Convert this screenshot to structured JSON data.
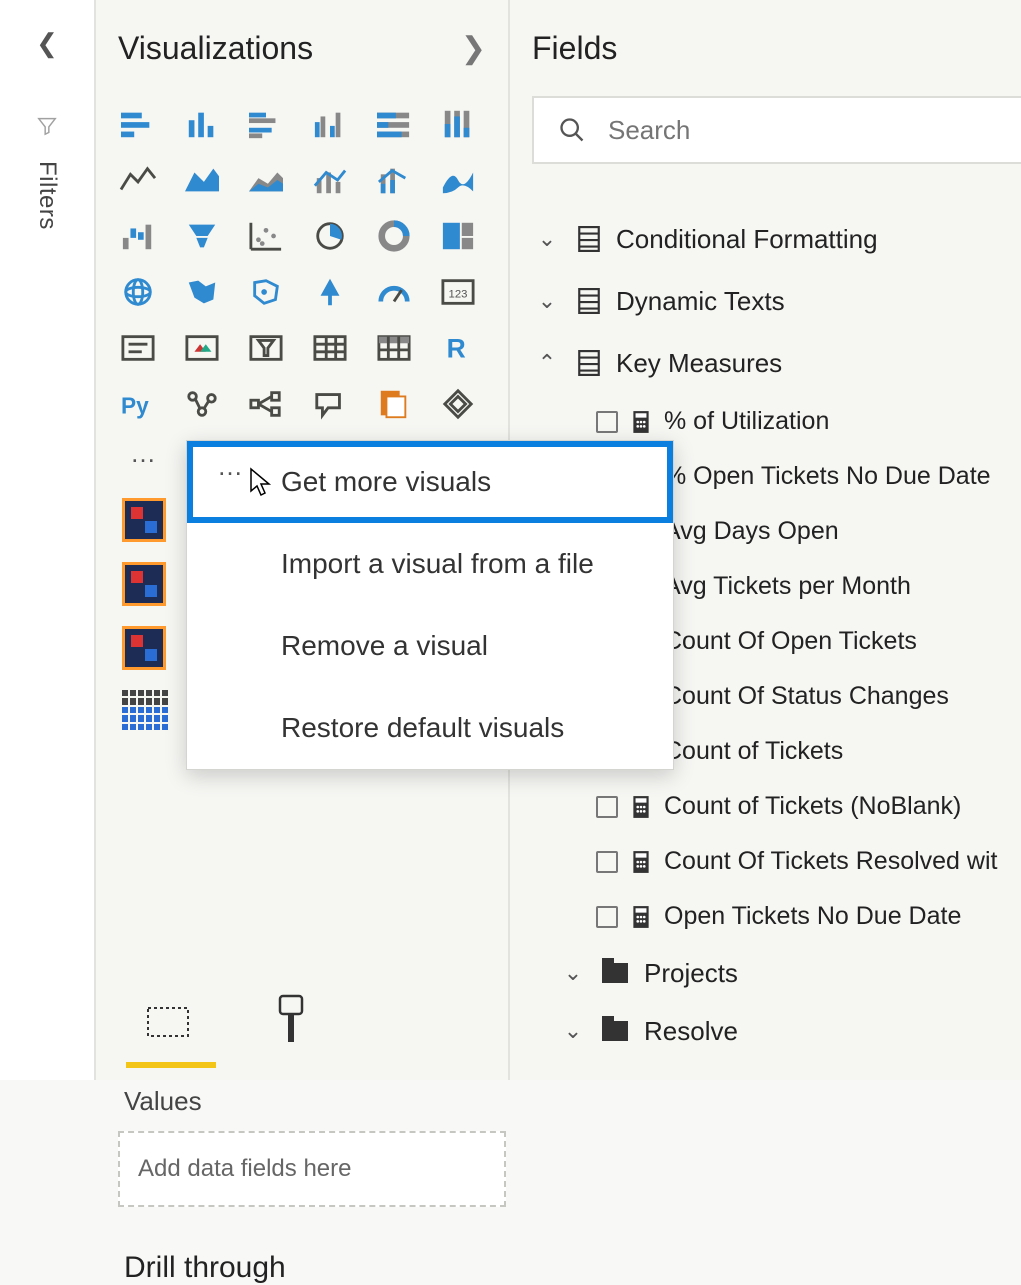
{
  "filters_rail": {
    "label": "Filters"
  },
  "viz": {
    "title": "Visualizations",
    "values_label": "Values",
    "drop_hint": "Add data fields here",
    "drill_label": "Drill through",
    "icons": [
      {
        "name": "stacked-bar-h"
      },
      {
        "name": "stacked-column"
      },
      {
        "name": "clustered-bar-h"
      },
      {
        "name": "clustered-column"
      },
      {
        "name": "hundred-bar-h"
      },
      {
        "name": "hundred-column"
      },
      {
        "name": "line-chart"
      },
      {
        "name": "area-chart"
      },
      {
        "name": "stacked-area"
      },
      {
        "name": "line-clustered"
      },
      {
        "name": "line-stacked"
      },
      {
        "name": "ribbon-chart"
      },
      {
        "name": "waterfall"
      },
      {
        "name": "funnel"
      },
      {
        "name": "scatter"
      },
      {
        "name": "pie"
      },
      {
        "name": "donut"
      },
      {
        "name": "treemap"
      },
      {
        "name": "map-globe"
      },
      {
        "name": "filled-map"
      },
      {
        "name": "shape-map"
      },
      {
        "name": "arrow-nav"
      },
      {
        "name": "gauge"
      },
      {
        "name": "card-kpi"
      },
      {
        "name": "card"
      },
      {
        "name": "multi-card"
      },
      {
        "name": "slicer"
      },
      {
        "name": "table"
      },
      {
        "name": "matrix"
      },
      {
        "name": "r-visual"
      },
      {
        "name": "py-visual"
      },
      {
        "name": "key-influencers"
      },
      {
        "name": "decomposition-tree"
      },
      {
        "name": "qa-visual"
      },
      {
        "name": "paginated"
      },
      {
        "name": "power-apps"
      }
    ]
  },
  "context_menu": {
    "items": [
      {
        "label": "Get more visuals",
        "highlighted": true
      },
      {
        "label": "Import a visual from a file"
      },
      {
        "label": "Remove a visual"
      },
      {
        "label": "Restore default visuals"
      }
    ]
  },
  "fields": {
    "title": "Fields",
    "search_placeholder": "Search",
    "tables": [
      {
        "name": "Conditional Formatting",
        "expanded": false,
        "type": "table"
      },
      {
        "name": "Dynamic Texts",
        "expanded": false,
        "type": "table"
      },
      {
        "name": "Key Measures",
        "expanded": true,
        "type": "table",
        "measures": [
          "% of Utilization",
          "% Open Tickets No Due Date",
          "Avg Days Open",
          "Avg Tickets per Month",
          "Count Of Open Tickets",
          "Count Of Status Changes",
          "Count of Tickets",
          "Count of Tickets (NoBlank)",
          "Count Of Tickets Resolved wit",
          "Open Tickets No Due Date"
        ],
        "folders": [
          {
            "name": "Projects"
          },
          {
            "name": "Resolve"
          }
        ]
      }
    ]
  }
}
